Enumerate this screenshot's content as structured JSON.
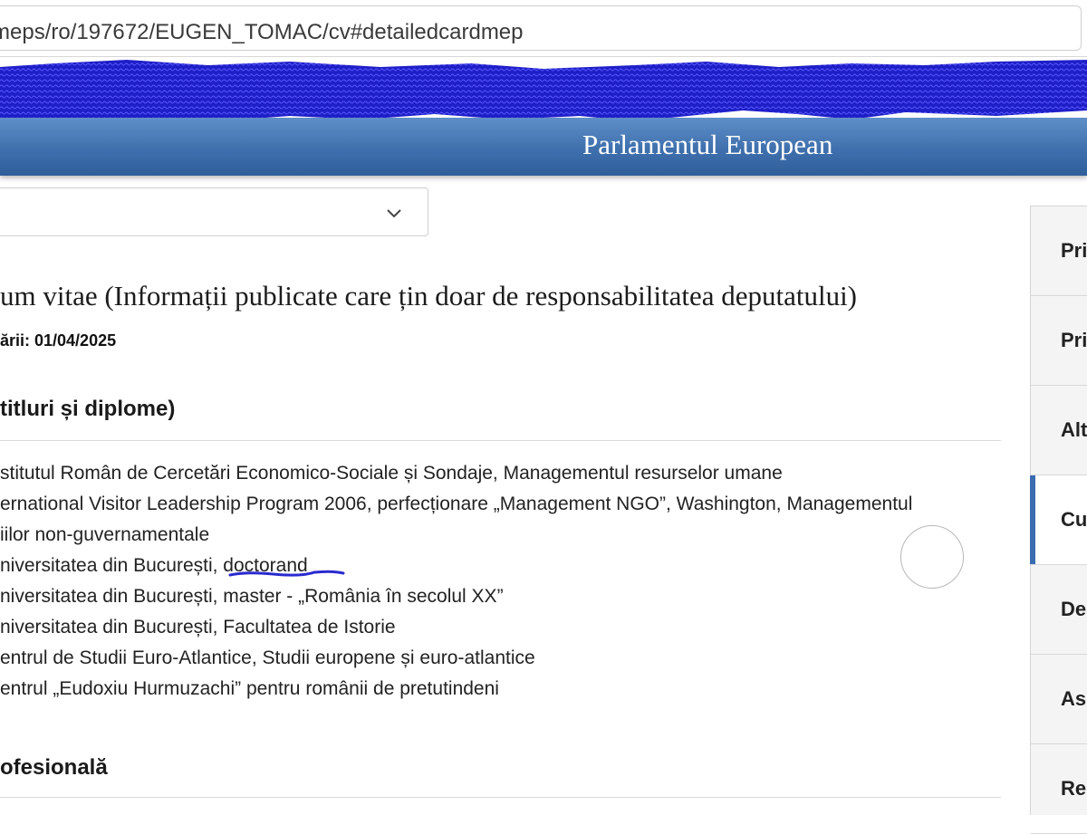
{
  "browser": {
    "url": "meps/ro/197672/EUGEN_TOMAC/cv#detailedcardmep"
  },
  "header": {
    "title": "Parlamentul European",
    "band_color": "#3f70ad",
    "redaction_color": "#1f1fc8"
  },
  "dropdown": {
    "icon": "chevron-down-icon"
  },
  "main": {
    "cv_title": "um vitae   (Informații publicate care țin doar de responsabilitatea deputatului)",
    "update_line": "ării: 01/04/2025",
    "education_heading": "titluri și diplome)",
    "education_items": [
      "stitutul Român de Cercetări Economico-Sociale și Sondaje, Managementul resurselor umane",
      "ernational Visitor Leadership Program 2006, perfecționare „Management NGO”, Washington, Managementul",
      "iilor non-guvernamentale",
      "niversitatea din București, doctorand",
      "niversitatea din București, master - „România în secolul XX”",
      "niversitatea din București, Facultatea de Istorie",
      "entrul de Studii Euro-Atlantice, Studii europene și euro-atlantice",
      "entrul „Eudoxiu Hurmuzachi” pentru românii de pretutindeni"
    ],
    "career_heading": "ofesională",
    "annotation_color": "#2a2ad0"
  },
  "sidebar": {
    "items": [
      {
        "label": "Pri",
        "active": false
      },
      {
        "label": "Pri",
        "active": false
      },
      {
        "label": "Alt",
        "active": false
      },
      {
        "label": "Cu",
        "active": true
      },
      {
        "label": "De",
        "active": false
      },
      {
        "label": "As",
        "active": false
      },
      {
        "label": "Re",
        "active": false
      }
    ],
    "active_color": "#3a6cb0"
  }
}
